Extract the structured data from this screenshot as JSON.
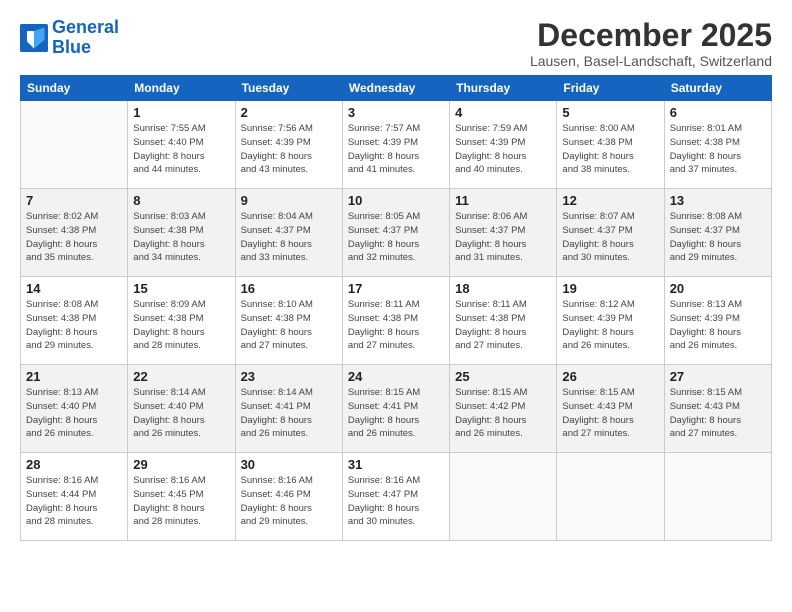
{
  "logo": {
    "line1": "General",
    "line2": "Blue"
  },
  "title": "December 2025",
  "subtitle": "Lausen, Basel-Landschaft, Switzerland",
  "weekdays": [
    "Sunday",
    "Monday",
    "Tuesday",
    "Wednesday",
    "Thursday",
    "Friday",
    "Saturday"
  ],
  "weeks": [
    {
      "shade": "white",
      "days": [
        {
          "num": "",
          "info": ""
        },
        {
          "num": "1",
          "info": "Sunrise: 7:55 AM\nSunset: 4:40 PM\nDaylight: 8 hours\nand 44 minutes."
        },
        {
          "num": "2",
          "info": "Sunrise: 7:56 AM\nSunset: 4:39 PM\nDaylight: 8 hours\nand 43 minutes."
        },
        {
          "num": "3",
          "info": "Sunrise: 7:57 AM\nSunset: 4:39 PM\nDaylight: 8 hours\nand 41 minutes."
        },
        {
          "num": "4",
          "info": "Sunrise: 7:59 AM\nSunset: 4:39 PM\nDaylight: 8 hours\nand 40 minutes."
        },
        {
          "num": "5",
          "info": "Sunrise: 8:00 AM\nSunset: 4:38 PM\nDaylight: 8 hours\nand 38 minutes."
        },
        {
          "num": "6",
          "info": "Sunrise: 8:01 AM\nSunset: 4:38 PM\nDaylight: 8 hours\nand 37 minutes."
        }
      ]
    },
    {
      "shade": "shaded",
      "days": [
        {
          "num": "7",
          "info": "Sunrise: 8:02 AM\nSunset: 4:38 PM\nDaylight: 8 hours\nand 35 minutes."
        },
        {
          "num": "8",
          "info": "Sunrise: 8:03 AM\nSunset: 4:38 PM\nDaylight: 8 hours\nand 34 minutes."
        },
        {
          "num": "9",
          "info": "Sunrise: 8:04 AM\nSunset: 4:37 PM\nDaylight: 8 hours\nand 33 minutes."
        },
        {
          "num": "10",
          "info": "Sunrise: 8:05 AM\nSunset: 4:37 PM\nDaylight: 8 hours\nand 32 minutes."
        },
        {
          "num": "11",
          "info": "Sunrise: 8:06 AM\nSunset: 4:37 PM\nDaylight: 8 hours\nand 31 minutes."
        },
        {
          "num": "12",
          "info": "Sunrise: 8:07 AM\nSunset: 4:37 PM\nDaylight: 8 hours\nand 30 minutes."
        },
        {
          "num": "13",
          "info": "Sunrise: 8:08 AM\nSunset: 4:37 PM\nDaylight: 8 hours\nand 29 minutes."
        }
      ]
    },
    {
      "shade": "white",
      "days": [
        {
          "num": "14",
          "info": "Sunrise: 8:08 AM\nSunset: 4:38 PM\nDaylight: 8 hours\nand 29 minutes."
        },
        {
          "num": "15",
          "info": "Sunrise: 8:09 AM\nSunset: 4:38 PM\nDaylight: 8 hours\nand 28 minutes."
        },
        {
          "num": "16",
          "info": "Sunrise: 8:10 AM\nSunset: 4:38 PM\nDaylight: 8 hours\nand 27 minutes."
        },
        {
          "num": "17",
          "info": "Sunrise: 8:11 AM\nSunset: 4:38 PM\nDaylight: 8 hours\nand 27 minutes."
        },
        {
          "num": "18",
          "info": "Sunrise: 8:11 AM\nSunset: 4:38 PM\nDaylight: 8 hours\nand 27 minutes."
        },
        {
          "num": "19",
          "info": "Sunrise: 8:12 AM\nSunset: 4:39 PM\nDaylight: 8 hours\nand 26 minutes."
        },
        {
          "num": "20",
          "info": "Sunrise: 8:13 AM\nSunset: 4:39 PM\nDaylight: 8 hours\nand 26 minutes."
        }
      ]
    },
    {
      "shade": "shaded",
      "days": [
        {
          "num": "21",
          "info": "Sunrise: 8:13 AM\nSunset: 4:40 PM\nDaylight: 8 hours\nand 26 minutes."
        },
        {
          "num": "22",
          "info": "Sunrise: 8:14 AM\nSunset: 4:40 PM\nDaylight: 8 hours\nand 26 minutes."
        },
        {
          "num": "23",
          "info": "Sunrise: 8:14 AM\nSunset: 4:41 PM\nDaylight: 8 hours\nand 26 minutes."
        },
        {
          "num": "24",
          "info": "Sunrise: 8:15 AM\nSunset: 4:41 PM\nDaylight: 8 hours\nand 26 minutes."
        },
        {
          "num": "25",
          "info": "Sunrise: 8:15 AM\nSunset: 4:42 PM\nDaylight: 8 hours\nand 26 minutes."
        },
        {
          "num": "26",
          "info": "Sunrise: 8:15 AM\nSunset: 4:43 PM\nDaylight: 8 hours\nand 27 minutes."
        },
        {
          "num": "27",
          "info": "Sunrise: 8:15 AM\nSunset: 4:43 PM\nDaylight: 8 hours\nand 27 minutes."
        }
      ]
    },
    {
      "shade": "white",
      "days": [
        {
          "num": "28",
          "info": "Sunrise: 8:16 AM\nSunset: 4:44 PM\nDaylight: 8 hours\nand 28 minutes."
        },
        {
          "num": "29",
          "info": "Sunrise: 8:16 AM\nSunset: 4:45 PM\nDaylight: 8 hours\nand 28 minutes."
        },
        {
          "num": "30",
          "info": "Sunrise: 8:16 AM\nSunset: 4:46 PM\nDaylight: 8 hours\nand 29 minutes."
        },
        {
          "num": "31",
          "info": "Sunrise: 8:16 AM\nSunset: 4:47 PM\nDaylight: 8 hours\nand 30 minutes."
        },
        {
          "num": "",
          "info": ""
        },
        {
          "num": "",
          "info": ""
        },
        {
          "num": "",
          "info": ""
        }
      ]
    }
  ]
}
